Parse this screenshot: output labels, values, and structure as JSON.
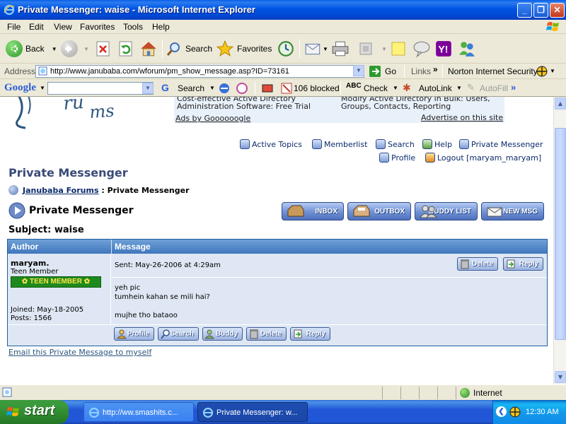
{
  "window": {
    "title": "Private Messenger: waise - Microsoft Internet Explorer",
    "minimize": "_",
    "maximize": "❐",
    "close": "✕"
  },
  "menu": [
    "File",
    "Edit",
    "View",
    "Favorites",
    "Tools",
    "Help"
  ],
  "toolbar": {
    "back": "Back",
    "search": "Search",
    "favorites": "Favorites"
  },
  "address": {
    "label": "Address",
    "url": "http://www.janubaba.com/wforum/pm_show_message.asp?ID=73161",
    "go": "Go",
    "links": "Links",
    "norton": "Norton Internet Security"
  },
  "googlebar": {
    "logo": "Google",
    "search": "Search",
    "blocked": "106 blocked",
    "check": "Check",
    "autolink": "AutoLink",
    "autofill": "AutoFill",
    "more": "»"
  },
  "ads": {
    "left_line1": "Cost-effective Active Directory",
    "left_line2": "Administration Software: Free Trial",
    "right_line1": "Modify Active Directory in Bulk: Users,",
    "right_line2": "Groups, Contacts, Reporting",
    "ads_by": "Ads by Goooooogle",
    "advertise": "Advertise on this site"
  },
  "forum_nav": {
    "active_topics": "Active Topics",
    "memberlist": "Memberlist",
    "search": "Search",
    "help": "Help",
    "private_messenger": "Private Messenger",
    "profile": "Profile",
    "logout": "Logout [maryam_maryam]"
  },
  "page": {
    "heading": "Private Messenger",
    "breadcrumb_forum": "Janubaba Forums",
    "breadcrumb_sep": " : ",
    "breadcrumb_current": "Private Messenger",
    "section_title": "Private Messenger",
    "subject_label": "Subject: waise",
    "email_link": "Email this Private Message to myself"
  },
  "msg_buttons": {
    "inbox": "INBOX",
    "outbox": "OUTBOX",
    "buddy_list": "BUDDY LIST",
    "new_msg": "NEW MSG"
  },
  "table": {
    "col_author": "Author",
    "col_message": "Message"
  },
  "author": {
    "name": "maryam.",
    "rank": "Teen Member",
    "badge": "TEEN MEMBER",
    "joined": "Joined: May-18-2005",
    "posts": "Posts: 1566"
  },
  "message": {
    "sent": "Sent: May-26-2006 at 4:29am",
    "line1": "yeh pic",
    "line2": "tumhein kahan se mili hai?",
    "line3": "mujhe tho bataoo",
    "delete": "Delete",
    "reply": "Reply"
  },
  "author_buttons": {
    "profile": "Profile",
    "search": "Search",
    "buddy": "Buddy",
    "delete": "Delete",
    "reply": "Reply"
  },
  "status": {
    "zone": "Internet"
  },
  "taskbar": {
    "start": "start",
    "task1": "http://ww.smashits.c...",
    "task2": "Private Messenger: w...",
    "clock": "12:30 AM"
  },
  "colors": {
    "heading": "#3A4A78",
    "link": "#0B2A6B",
    "table_border": "#1F5D9C"
  }
}
